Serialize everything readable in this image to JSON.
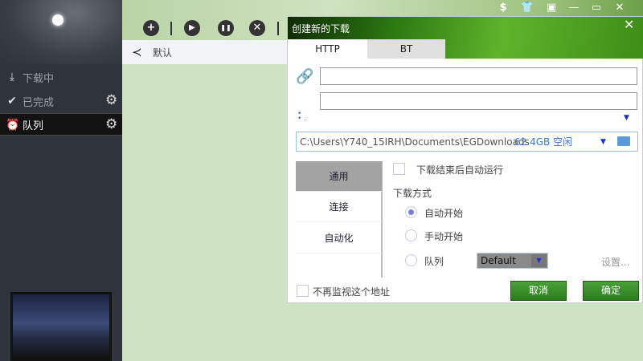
{
  "sidebar": {
    "items": [
      {
        "label": "下载中",
        "icon": "download-icon"
      },
      {
        "label": "已完成",
        "icon": "check-circle-icon"
      },
      {
        "label": "队列",
        "icon": "alarm-clock-icon",
        "selected": true
      }
    ]
  },
  "toolbar": {
    "add": "+",
    "play": "▶",
    "pause": "❚❚",
    "stop": "✕"
  },
  "breadcrumb": {
    "label": "默认"
  },
  "window": {
    "dollar": "$",
    "close": "✕"
  },
  "dialog": {
    "title": "创建新的下载",
    "close": "✕",
    "tabs": [
      "HTTP",
      "BT"
    ],
    "url_value": "",
    "name_value": "",
    "path": "C:\\Users\\Y740_15IRH\\Documents\\EGDownloads",
    "free_space": "62.4GB 空闲",
    "side_tabs": [
      "通用",
      "连接",
      "自动化"
    ],
    "auto_run_label": "下载结束后自动运行",
    "mode_label": "下载方式",
    "modes": [
      "自动开始",
      "手动开始",
      "队列"
    ],
    "selected_mode": 0,
    "queue_value": "Default",
    "settings_link": "设置...",
    "no_monitor_label": "不再监视这个地址",
    "cancel": "取消",
    "ok": "确定"
  }
}
